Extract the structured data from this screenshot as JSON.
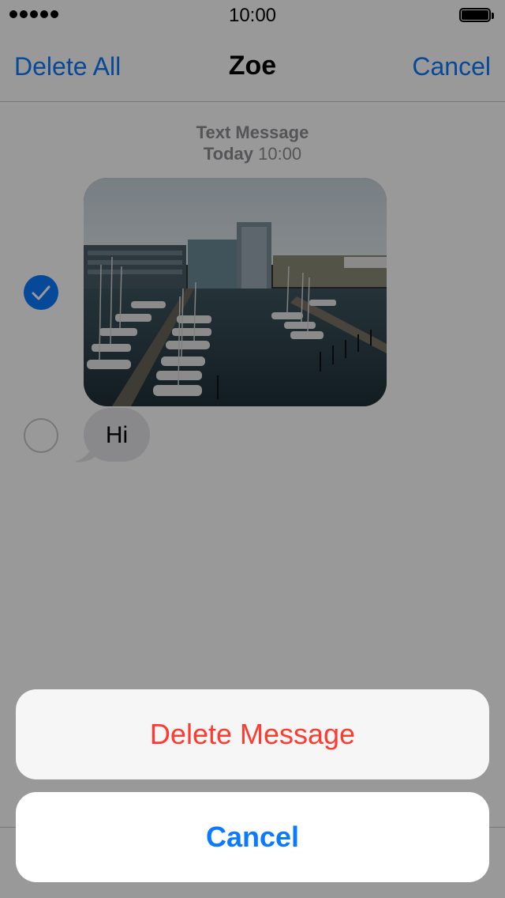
{
  "status_bar": {
    "time": "10:00",
    "signal_icon": "signal-dots-icon",
    "battery_icon": "battery-icon"
  },
  "nav": {
    "left": "Delete All",
    "title": "Zoe",
    "right": "Cancel"
  },
  "thread": {
    "service": "Text Message",
    "day": "Today",
    "time": "10:00",
    "messages": [
      {
        "type": "image",
        "selected": true,
        "image_icon": "harbor-photo"
      },
      {
        "type": "text",
        "text": "Hi",
        "selected": false
      }
    ]
  },
  "action_sheet": {
    "destructive_label": "Delete Message",
    "cancel_label": "Cancel"
  },
  "colors": {
    "accent": "#0a7aff",
    "destructive": "#ff3b30",
    "bubble_gray": "#e5e5ea"
  }
}
